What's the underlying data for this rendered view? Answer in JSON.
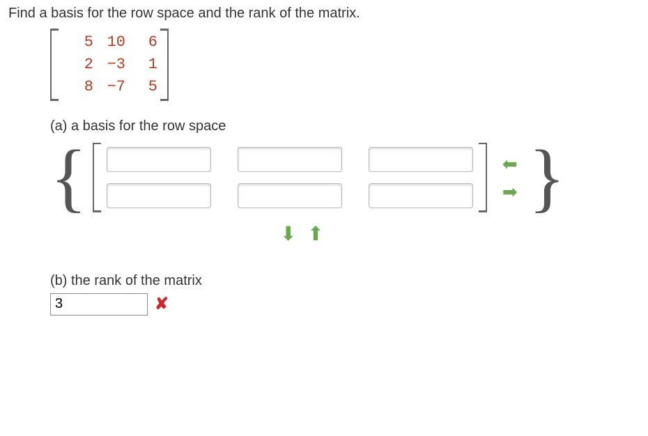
{
  "prompt": "Find a basis for the row space and the rank of the matrix.",
  "matrix": {
    "rows": [
      [
        "5",
        "10",
        "6"
      ],
      [
        "2",
        "−3",
        "1"
      ],
      [
        "8",
        "−7",
        "5"
      ]
    ]
  },
  "part_a": {
    "label": "(a) a basis for the row space",
    "basis_inputs": [
      [
        "",
        "",
        ""
      ],
      [
        "",
        "",
        ""
      ]
    ]
  },
  "part_b": {
    "label": "(b) the rank of the matrix",
    "value": "3",
    "correct": false
  },
  "chart_data": {
    "type": "table",
    "title": "Given matrix",
    "rows": 3,
    "cols": 3,
    "values": [
      [
        5,
        10,
        6
      ],
      [
        2,
        -3,
        1
      ],
      [
        8,
        -7,
        5
      ]
    ]
  },
  "icons": {
    "arrow_left": "⬅",
    "arrow_right": "➡",
    "arrow_down": "⬇",
    "arrow_up": "⬆",
    "x": "✘"
  }
}
